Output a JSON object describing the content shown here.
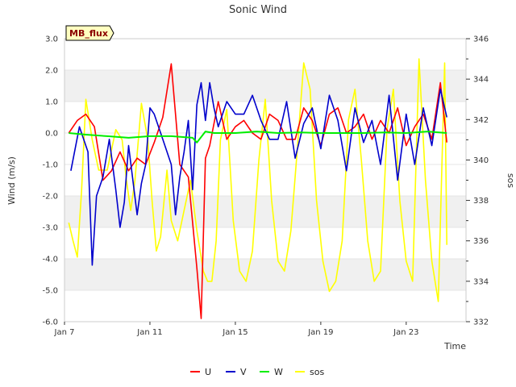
{
  "chart_data": {
    "type": "line",
    "title": "Sonic Wind",
    "site_label": "MB_flux",
    "xlabel": "Time",
    "ylabel": "Wind (m/s)",
    "y2label": "sos",
    "x_domain_days": [
      0,
      18.8
    ],
    "xticks": [
      {
        "day": 0,
        "label": "Jan 7"
      },
      {
        "day": 4,
        "label": "Jan 11"
      },
      {
        "day": 8,
        "label": "Jan 15"
      },
      {
        "day": 12,
        "label": "Jan 19"
      },
      {
        "day": 16,
        "label": "Jan 23"
      }
    ],
    "ylim": [
      -6.0,
      3.0
    ],
    "yticks": [
      "-6.0",
      "-5.0",
      "-4.0",
      "-3.0",
      "-2.0",
      "-1.0",
      "0.0",
      "1.0",
      "2.0",
      "3.0"
    ],
    "y2lim": [
      332,
      346
    ],
    "y2ticks": [
      "332",
      "334",
      "336",
      "338",
      "340",
      "342",
      "344",
      "346"
    ],
    "grid": "horizontal bands",
    "legend_position": "bottom-center",
    "colors": {
      "U": "#ff0000",
      "V": "#0000cc",
      "W": "#00ee00",
      "sos": "#ffff00"
    },
    "series": [
      {
        "name": "U",
        "axis": "left",
        "x": [
          0.2,
          0.6,
          1.0,
          1.4,
          1.8,
          2.2,
          2.6,
          3.0,
          3.4,
          3.8,
          4.2,
          4.6,
          5.0,
          5.4,
          5.8,
          6.2,
          6.4,
          6.6,
          6.8,
          7.2,
          7.6,
          8.0,
          8.4,
          8.8,
          9.2,
          9.6,
          10.0,
          10.4,
          10.8,
          11.2,
          11.6,
          12.0,
          12.4,
          12.8,
          13.2,
          13.6,
          14.0,
          14.4,
          14.8,
          15.2,
          15.6,
          16.0,
          16.4,
          16.8,
          17.2,
          17.6,
          17.9
        ],
        "y": [
          0.0,
          0.4,
          0.6,
          0.2,
          -1.5,
          -1.2,
          -0.6,
          -1.2,
          -0.8,
          -1.0,
          -0.3,
          0.5,
          2.2,
          -1.0,
          -1.4,
          -4.3,
          -5.9,
          -0.8,
          -0.4,
          1.0,
          -0.2,
          0.2,
          0.4,
          0.0,
          -0.2,
          0.6,
          0.4,
          -0.2,
          -0.2,
          0.8,
          0.4,
          -0.4,
          0.6,
          0.8,
          0.0,
          0.2,
          0.6,
          -0.2,
          0.4,
          0.0,
          0.8,
          -0.4,
          0.2,
          0.6,
          -0.2,
          1.6,
          -0.3
        ]
      },
      {
        "name": "V",
        "axis": "left",
        "x": [
          0.3,
          0.7,
          1.1,
          1.3,
          1.5,
          1.8,
          2.1,
          2.4,
          2.6,
          2.8,
          3.0,
          3.4,
          3.6,
          3.8,
          4.0,
          4.2,
          4.6,
          5.0,
          5.2,
          5.4,
          5.6,
          5.8,
          6.0,
          6.2,
          6.4,
          6.6,
          6.8,
          7.0,
          7.2,
          7.6,
          8.0,
          8.4,
          8.8,
          9.2,
          9.6,
          10.0,
          10.4,
          10.8,
          11.2,
          11.6,
          12.0,
          12.4,
          12.8,
          13.2,
          13.6,
          14.0,
          14.4,
          14.8,
          15.2,
          15.6,
          16.0,
          16.4,
          16.8,
          17.2,
          17.6,
          17.9
        ],
        "y": [
          -1.2,
          0.2,
          -0.6,
          -4.2,
          -2.0,
          -1.4,
          -0.2,
          -1.8,
          -3.0,
          -2.2,
          -0.4,
          -2.6,
          -1.6,
          -1.0,
          0.8,
          0.6,
          -0.2,
          -1.0,
          -2.6,
          -1.4,
          -0.6,
          0.4,
          -1.8,
          0.9,
          1.6,
          0.4,
          1.6,
          0.8,
          0.2,
          1.0,
          0.6,
          0.6,
          1.2,
          0.4,
          -0.2,
          -0.2,
          1.0,
          -0.8,
          0.3,
          0.8,
          -0.5,
          1.2,
          0.4,
          -1.2,
          0.8,
          -0.3,
          0.4,
          -1.0,
          1.2,
          -1.5,
          0.6,
          -1.0,
          0.8,
          -0.4,
          1.4,
          0.5
        ]
      },
      {
        "name": "W",
        "axis": "left",
        "x": [
          0.2,
          1.0,
          2.0,
          3.0,
          4.0,
          5.0,
          6.0,
          6.2,
          6.6,
          7.0,
          8.0,
          9.0,
          10.0,
          11.0,
          12.0,
          13.0,
          14.0,
          15.0,
          16.0,
          17.0,
          17.9
        ],
        "y": [
          0.0,
          -0.05,
          -0.1,
          -0.15,
          -0.1,
          -0.1,
          -0.15,
          -0.3,
          0.05,
          0.0,
          0.0,
          0.05,
          0.0,
          0.02,
          0.0,
          0.0,
          0.0,
          0.02,
          0.0,
          0.05,
          0.0
        ]
      },
      {
        "name": "sos",
        "axis": "right",
        "x": [
          0.2,
          0.4,
          0.6,
          0.8,
          1.0,
          1.3,
          1.6,
          2.0,
          2.4,
          2.7,
          2.9,
          3.1,
          3.3,
          3.6,
          3.9,
          4.1,
          4.3,
          4.5,
          4.8,
          5.0,
          5.3,
          5.6,
          5.9,
          6.2,
          6.5,
          6.7,
          6.9,
          7.1,
          7.3,
          7.6,
          7.9,
          8.2,
          8.5,
          8.8,
          9.1,
          9.4,
          9.7,
          10.0,
          10.3,
          10.6,
          10.9,
          11.2,
          11.5,
          11.8,
          12.1,
          12.4,
          12.7,
          13.0,
          13.3,
          13.6,
          13.9,
          14.2,
          14.5,
          14.8,
          15.1,
          15.4,
          15.7,
          16.0,
          16.3,
          16.6,
          16.9,
          17.2,
          17.5,
          17.8,
          17.9
        ],
        "y": [
          336.9,
          336.0,
          335.2,
          338.5,
          343.0,
          341.0,
          339.5,
          339.5,
          341.5,
          341.0,
          339.0,
          337.5,
          339.0,
          342.8,
          341.0,
          338.0,
          335.5,
          336.2,
          339.5,
          337.0,
          336.0,
          337.5,
          339.0,
          336.5,
          334.5,
          334.0,
          334.0,
          336.0,
          341.0,
          342.5,
          337.0,
          334.5,
          334.0,
          335.5,
          340.0,
          343.0,
          338.0,
          335.0,
          334.5,
          336.5,
          340.5,
          344.8,
          343.5,
          338.0,
          335.0,
          333.5,
          334.0,
          336.0,
          342.0,
          343.5,
          340.0,
          336.0,
          334.0,
          334.5,
          341.5,
          343.5,
          338.0,
          335.0,
          334.0,
          345.0,
          339.0,
          335.0,
          333.0,
          344.8,
          335.8
        ]
      }
    ]
  }
}
